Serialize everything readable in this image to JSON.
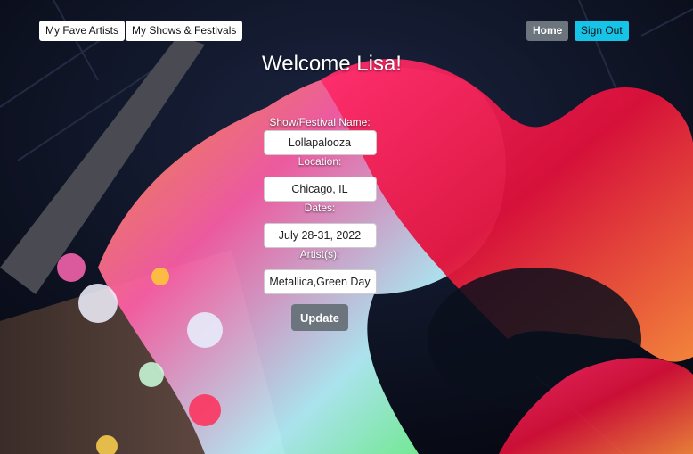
{
  "nav": {
    "fave_artists": "My Fave Artists",
    "shows_festivals": "My Shows & Festivals",
    "home": "Home",
    "sign_out": "Sign Out"
  },
  "welcome": "Welcome Lisa!",
  "form": {
    "show_label": "Show/Festival Name:",
    "show_value": "Lollapalooza",
    "location_label": "Location:",
    "location_value": "Chicago, IL",
    "dates_label": "Dates:",
    "dates_value": "July 28-31, 2022",
    "artists_label": "Artist(s):",
    "artists_value": "Metallica,Green Day",
    "update_label": "Update"
  }
}
